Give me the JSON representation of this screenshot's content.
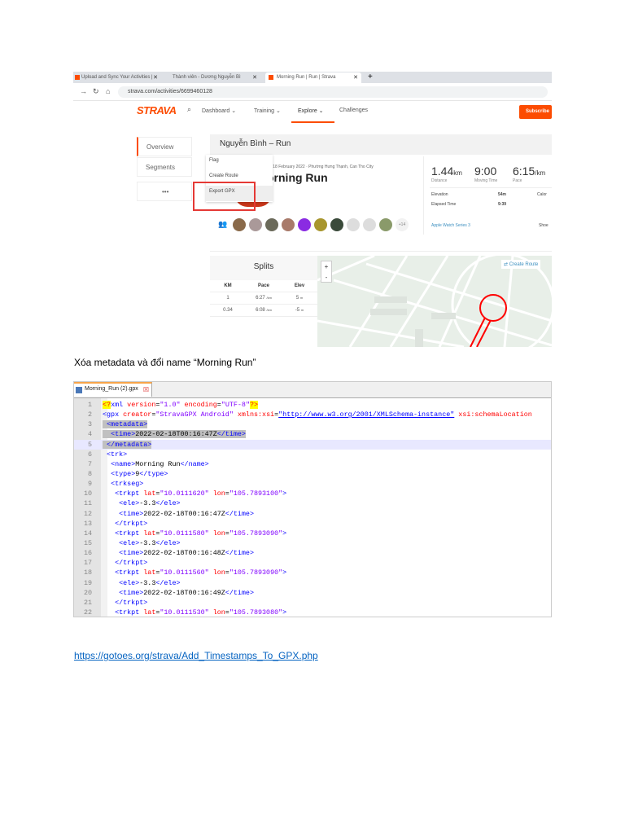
{
  "browser": {
    "tabs": [
      {
        "label": "Upload and Sync Your Activities |",
        "close": "✕"
      },
      {
        "label": "Thành viên - Dương Nguyễn Bì",
        "close": "✕"
      },
      {
        "label": "Morning Run | Run | Strava",
        "close": "✕"
      }
    ],
    "new_tab": "+",
    "url": "strava.com/activities/6699460128"
  },
  "strava": {
    "logo": "STRAVA",
    "nav": [
      "Dashboard ⌄",
      "Training ⌄",
      "Explore ⌄",
      "Challenges"
    ],
    "subscribe": "Subscribe",
    "sidebar": [
      "Overview",
      "Segments",
      "•••"
    ],
    "header": "Nguyễn Bình – Run",
    "menu": [
      "Flag",
      "Create Route",
      "Export GPX"
    ],
    "date_location": "riday, 18 February 2022 · Phường Hưng Thạnh, Can Tho City",
    "activity_title": "orning Run",
    "stats": [
      {
        "value": "1.44",
        "unit": "km",
        "label": "Distance"
      },
      {
        "value": "9:00",
        "unit": "",
        "label": "Moving Time"
      },
      {
        "value": "6:15",
        "unit": "/km",
        "label": "Pace"
      }
    ],
    "minor_stats": [
      {
        "label": "Elevation",
        "value": "54m"
      },
      {
        "label": "Elapsed Time",
        "value": "9:39"
      }
    ],
    "calories_label": "Calor",
    "device": "Apple Watch Series 3",
    "shoes_label": "Shoe",
    "more_athletes": "+14",
    "splits": {
      "title": "Splits",
      "headers": [
        "KM",
        "Pace",
        "Elev"
      ],
      "rows": [
        {
          "km": "1",
          "pace": "6:27",
          "pace_unit": "/km",
          "elev": "5",
          "elev_unit": "m"
        },
        {
          "km": "0.34",
          "pace": "6:08",
          "pace_unit": "/km",
          "elev": "-5",
          "elev_unit": "m"
        }
      ]
    },
    "map": {
      "zoom_in": "+",
      "zoom_out": "-",
      "create_route": "Create Route"
    }
  },
  "caption": "Xóa metadata và đổi name “Morning Run”",
  "editor": {
    "file_tab": "Morning_Run (2).gpx",
    "lines": [
      [
        [
          "pi",
          "<?"
        ],
        [
          "tag",
          "xml "
        ],
        [
          "attr",
          "version"
        ],
        [
          "txt",
          "="
        ],
        [
          "val",
          "\"1.0\""
        ],
        [
          "attr",
          " encoding"
        ],
        [
          "txt",
          "="
        ],
        [
          "val",
          "\"UTF-8\""
        ],
        [
          "pi",
          "?>"
        ]
      ],
      [
        [
          "tag",
          "<gpx "
        ],
        [
          "attr",
          "creator"
        ],
        [
          "txt",
          "="
        ],
        [
          "val",
          "\"StravaGPX Android\""
        ],
        [
          "attr",
          " xmlns:xsi"
        ],
        [
          "txt",
          "="
        ],
        [
          "url",
          "\"http://www.w3.org/2001/XMLSchema-instance\""
        ],
        [
          "attr",
          " xsi:schemaLocation"
        ]
      ],
      [
        [
          "sel",
          " "
        ],
        [
          "tag",
          "<metadata>"
        ]
      ],
      [
        [
          "sel",
          "  "
        ],
        [
          "tag",
          "<time>"
        ],
        [
          "txt",
          "2022-02-18T00:16:47Z"
        ],
        [
          "tag",
          "</time>"
        ]
      ],
      [
        [
          "sel",
          " "
        ],
        [
          "tag",
          "</metadata>"
        ]
      ],
      [
        [
          "txt",
          " "
        ],
        [
          "tag",
          "<trk>"
        ]
      ],
      [
        [
          "txt",
          "  "
        ],
        [
          "tag",
          "<name>"
        ],
        [
          "txt",
          "Morning Run"
        ],
        [
          "tag",
          "</name>"
        ]
      ],
      [
        [
          "txt",
          "  "
        ],
        [
          "tag",
          "<type>"
        ],
        [
          "txt",
          "9"
        ],
        [
          "tag",
          "</type>"
        ]
      ],
      [
        [
          "txt",
          "  "
        ],
        [
          "tag",
          "<trkseg>"
        ]
      ],
      [
        [
          "txt",
          "   "
        ],
        [
          "tag",
          "<trkpt "
        ],
        [
          "attr",
          "lat"
        ],
        [
          "txt",
          "="
        ],
        [
          "val",
          "\"10.0111620\""
        ],
        [
          "attr",
          " lon"
        ],
        [
          "txt",
          "="
        ],
        [
          "val",
          "\"105.7893100\""
        ],
        [
          "tag",
          ">"
        ]
      ],
      [
        [
          "txt",
          "    "
        ],
        [
          "tag",
          "<ele>"
        ],
        [
          "txt",
          "-3.3"
        ],
        [
          "tag",
          "</ele>"
        ]
      ],
      [
        [
          "txt",
          "    "
        ],
        [
          "tag",
          "<time>"
        ],
        [
          "txt",
          "2022-02-18T00:16:47Z"
        ],
        [
          "tag",
          "</time>"
        ]
      ],
      [
        [
          "txt",
          "   "
        ],
        [
          "tag",
          "</trkpt>"
        ]
      ],
      [
        [
          "txt",
          "   "
        ],
        [
          "tag",
          "<trkpt "
        ],
        [
          "attr",
          "lat"
        ],
        [
          "txt",
          "="
        ],
        [
          "val",
          "\"10.0111580\""
        ],
        [
          "attr",
          " lon"
        ],
        [
          "txt",
          "="
        ],
        [
          "val",
          "\"105.7893090\""
        ],
        [
          "tag",
          ">"
        ]
      ],
      [
        [
          "txt",
          "    "
        ],
        [
          "tag",
          "<ele>"
        ],
        [
          "txt",
          "-3.3"
        ],
        [
          "tag",
          "</ele>"
        ]
      ],
      [
        [
          "txt",
          "    "
        ],
        [
          "tag",
          "<time>"
        ],
        [
          "txt",
          "2022-02-18T00:16:48Z"
        ],
        [
          "tag",
          "</time>"
        ]
      ],
      [
        [
          "txt",
          "   "
        ],
        [
          "tag",
          "</trkpt>"
        ]
      ],
      [
        [
          "txt",
          "   "
        ],
        [
          "tag",
          "<trkpt "
        ],
        [
          "attr",
          "lat"
        ],
        [
          "txt",
          "="
        ],
        [
          "val",
          "\"10.0111560\""
        ],
        [
          "attr",
          " lon"
        ],
        [
          "txt",
          "="
        ],
        [
          "val",
          "\"105.7893090\""
        ],
        [
          "tag",
          ">"
        ]
      ],
      [
        [
          "txt",
          "    "
        ],
        [
          "tag",
          "<ele>"
        ],
        [
          "txt",
          "-3.3"
        ],
        [
          "tag",
          "</ele>"
        ]
      ],
      [
        [
          "txt",
          "    "
        ],
        [
          "tag",
          "<time>"
        ],
        [
          "txt",
          "2022-02-18T00:16:49Z"
        ],
        [
          "tag",
          "</time>"
        ]
      ],
      [
        [
          "txt",
          "   "
        ],
        [
          "tag",
          "</trkpt>"
        ]
      ],
      [
        [
          "txt",
          "   "
        ],
        [
          "tag",
          "<trkpt "
        ],
        [
          "attr",
          "lat"
        ],
        [
          "txt",
          "="
        ],
        [
          "val",
          "\"10.0111530\""
        ],
        [
          "attr",
          " lon"
        ],
        [
          "txt",
          "="
        ],
        [
          "val",
          "\"105.7893080\""
        ],
        [
          "tag",
          ">"
        ]
      ]
    ]
  },
  "link": "https://gotoes.org/strava/Add_Timestamps_To_GPX.php",
  "colors": {
    "strava_orange": "#fc4c02",
    "highlight_red": "#e53935",
    "link": "#0563c1"
  }
}
